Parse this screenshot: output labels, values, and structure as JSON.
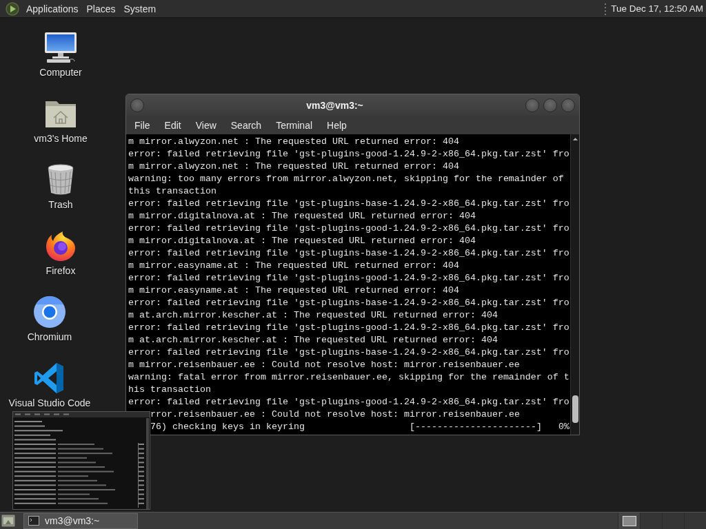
{
  "top_panel": {
    "menus": [
      "Applications",
      "Places",
      "System"
    ],
    "clock": "Tue Dec 17, 12:50 AM"
  },
  "desktop_icons": [
    {
      "kind": "computer",
      "label": "Computer"
    },
    {
      "kind": "home",
      "label": "vm3's Home"
    },
    {
      "kind": "trash",
      "label": "Trash"
    },
    {
      "kind": "firefox",
      "label": "Firefox"
    },
    {
      "kind": "chromium",
      "label": "Chromium"
    },
    {
      "kind": "vscode",
      "label": "Visual Studio Code"
    }
  ],
  "terminal": {
    "title": "vm3@vm3:~",
    "menu": [
      "File",
      "Edit",
      "View",
      "Search",
      "Terminal",
      "Help"
    ],
    "lines": [
      {
        "kind": "text",
        "text": "m mirror.alwyzon.net : The requested URL returned error: 404"
      },
      {
        "kind": "text",
        "text": "error: failed retrieving file 'gst-plugins-good-1.24.9-2-x86_64.pkg.tar.zst' fro"
      },
      {
        "kind": "text",
        "text": "m mirror.alwyzon.net : The requested URL returned error: 404"
      },
      {
        "kind": "text",
        "text": "warning: too many errors from mirror.alwyzon.net, skipping for the remainder of"
      },
      {
        "kind": "text",
        "text": "this transaction"
      },
      {
        "kind": "text",
        "text": "error: failed retrieving file 'gst-plugins-base-1.24.9-2-x86_64.pkg.tar.zst' fro"
      },
      {
        "kind": "text",
        "text": "m mirror.digitalnova.at : The requested URL returned error: 404"
      },
      {
        "kind": "text",
        "text": "error: failed retrieving file 'gst-plugins-good-1.24.9-2-x86_64.pkg.tar.zst' fro"
      },
      {
        "kind": "text",
        "text": "m mirror.digitalnova.at : The requested URL returned error: 404"
      },
      {
        "kind": "text",
        "text": "error: failed retrieving file 'gst-plugins-base-1.24.9-2-x86_64.pkg.tar.zst' fro"
      },
      {
        "kind": "text",
        "text": "m mirror.easyname.at : The requested URL returned error: 404"
      },
      {
        "kind": "text",
        "text": "error: failed retrieving file 'gst-plugins-good-1.24.9-2-x86_64.pkg.tar.zst' fro"
      },
      {
        "kind": "text",
        "text": "m mirror.easyname.at : The requested URL returned error: 404"
      },
      {
        "kind": "text",
        "text": "error: failed retrieving file 'gst-plugins-base-1.24.9-2-x86_64.pkg.tar.zst' fro"
      },
      {
        "kind": "text",
        "text": "m at.arch.mirror.kescher.at : The requested URL returned error: 404"
      },
      {
        "kind": "text",
        "text": "error: failed retrieving file 'gst-plugins-good-1.24.9-2-x86_64.pkg.tar.zst' fro"
      },
      {
        "kind": "text",
        "text": "m at.arch.mirror.kescher.at : The requested URL returned error: 404"
      },
      {
        "kind": "text",
        "text": "error: failed retrieving file 'gst-plugins-base-1.24.9-2-x86_64.pkg.tar.zst' fro"
      },
      {
        "kind": "text",
        "text": "m mirror.reisenbauer.ee : Could not resolve host: mirror.reisenbauer.ee"
      },
      {
        "kind": "text",
        "text": "warning: fatal error from mirror.reisenbauer.ee, skipping for the remainder of t"
      },
      {
        "kind": "text",
        "text": "his transaction"
      },
      {
        "kind": "text",
        "text": "error: failed retrieving file 'gst-plugins-good-1.24.9-2-x86_64.pkg.tar.zst' fro"
      },
      {
        "kind": "covered",
        "text": "rror.reisenbauer.ee : Could not resolve host: mirror.reisenbauer.ee"
      },
      {
        "kind": "progress",
        "text": "76) checking keys in keyring",
        "bar": "[----------------------]",
        "percent": "0%"
      }
    ]
  },
  "taskbar": {
    "tasks": [
      {
        "label": "vm3@vm3:~",
        "selected": true
      }
    ],
    "workspaces": [
      {
        "selected": true
      },
      {
        "selected": false
      },
      {
        "selected": false
      },
      {
        "selected": false
      }
    ]
  }
}
